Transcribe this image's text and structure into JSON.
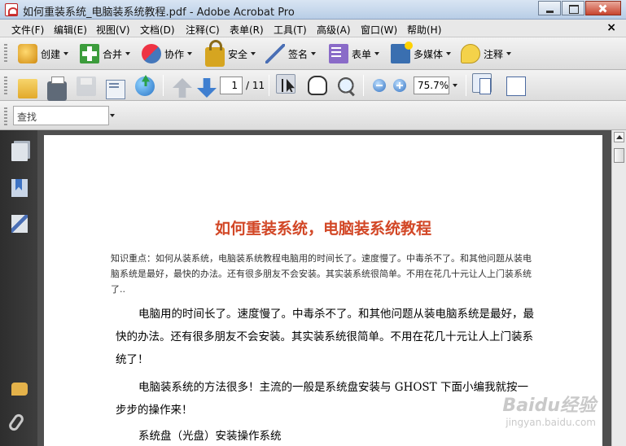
{
  "window": {
    "title": "如何重装系统_电脑装系统教程.pdf - Adobe Acrobat Pro"
  },
  "menubar": {
    "items": [
      "文件(F)",
      "编辑(E)",
      "视图(V)",
      "文档(D)",
      "注释(C)",
      "表单(R)",
      "工具(T)",
      "高级(A)",
      "窗口(W)",
      "帮助(H)"
    ],
    "close": "×"
  },
  "toolbar1": {
    "create": "创建",
    "combine": "合并",
    "collaborate": "协作",
    "secure": "安全",
    "sign": "签名",
    "forms": "表单",
    "multimedia": "多媒体",
    "comment": "注释"
  },
  "toolbar2": {
    "page_current": "1",
    "page_total": "/ 11",
    "zoom": "75.7%"
  },
  "toolbar3": {
    "find_placeholder": "查找"
  },
  "document": {
    "title": "如何重装系统，电脑装系统教程",
    "summary": "知识重点：如何从装系统，电脑装系统教程电脑用的时间长了。速度慢了。中毒杀不了。和其他问题从装电脑系统是最好，最快的办法。还有很多朋友不会安装。其实装系统很简单。不用在花几十元让人上门装系统了..",
    "para1": "电脑用的时间长了。速度慢了。中毒杀不了。和其他问题从装电脑系统是最好，最快的办法。还有很多朋友不会安装。其实装系统很简单。不用在花几十元让人上门装系统了！",
    "para2": "电脑装系统的方法很多！主流的一般是系统盘安装与 GHOST 下面小编我就按一步步的操作来！",
    "para3": "系统盘（光盘）安装操作系统"
  },
  "watermark": {
    "logo": "Baidu经验",
    "sub": "jingyan.baidu.com"
  },
  "colors": {
    "title_accent": "#d24726"
  }
}
